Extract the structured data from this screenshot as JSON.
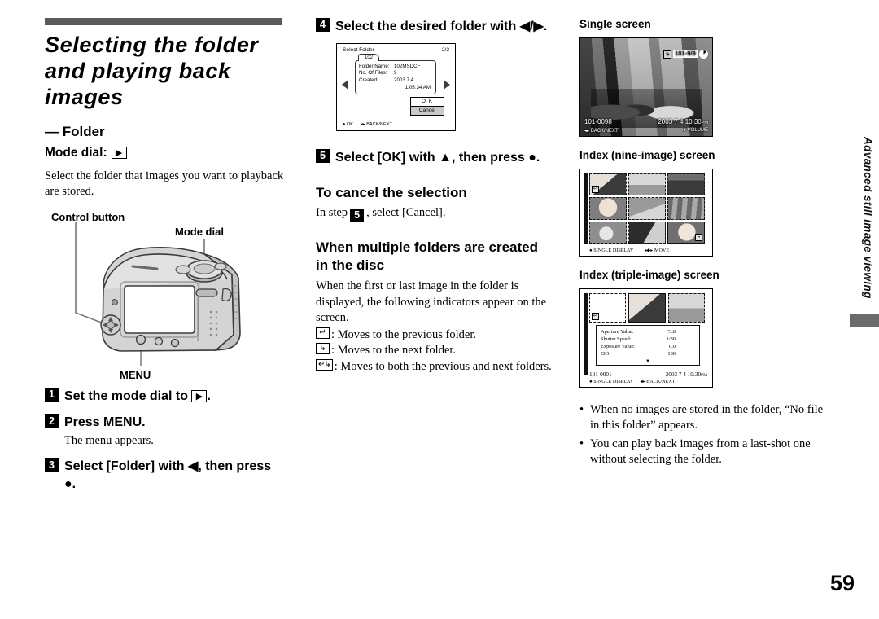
{
  "page_number": "59",
  "side_tab_text": "Advanced still image viewing",
  "left_column": {
    "title": "Selecting the folder and playing back images",
    "sub_head": "— Folder",
    "mode_dial_label": "Mode dial:",
    "mode_dial_icon": "playback-icon",
    "intro": "Select the folder that images you want to playback are stored.",
    "camera_labels": {
      "control_button": "Control button",
      "mode_dial": "Mode dial",
      "menu": "MENU"
    },
    "steps": [
      {
        "num": "1",
        "text": "Set the mode dial to ",
        "icon": "playback-icon",
        "tail": "."
      },
      {
        "num": "2",
        "text": "Press MENU.",
        "note": "The menu appears."
      },
      {
        "num": "3",
        "text": "Select [Folder] with ◀, then press ●."
      }
    ]
  },
  "middle_column": {
    "step4": {
      "num": "4",
      "text": "Select the desired folder with ◀/▶."
    },
    "select_folder_screen": {
      "title": "Select Folder",
      "counter": "2/2",
      "folder_tab": "102",
      "rows": [
        {
          "key": "Folder Name:",
          "value": "102MSDCF"
        },
        {
          "key": "No. Of Files:",
          "value": "9"
        },
        {
          "key": "Created:",
          "value": "2003  7  4"
        }
      ],
      "created_time": "1:05:34 AM",
      "ok_label": "O K",
      "cancel_label": "Cancel",
      "footer_ok": "OK",
      "footer_nav": "BACK/NEXT"
    },
    "step5": {
      "num": "5",
      "text": "Select [OK] with ▲, then press ●."
    },
    "cancel_head": "To cancel the selection",
    "cancel_text_a": "In step",
    "cancel_step_num": "5",
    "cancel_text_b": ", select [Cancel].",
    "multi_head": "When multiple folders are created in the disc",
    "multi_body": "When the first or last image in the folder is displayed, the following indicators appear on the screen.",
    "indicators": [
      {
        "icon": "previous-folder-icon",
        "glyph": "↵",
        "text": ": Moves to the previous folder."
      },
      {
        "icon": "next-folder-icon",
        "glyph": "↳",
        "text": ": Moves to the next folder."
      },
      {
        "icon": "both-folders-icon",
        "glyph": "↵↳",
        "text": ": Moves to both the previous and next folders."
      }
    ]
  },
  "right_column": {
    "single_screen": {
      "caption": "Single screen",
      "osd_folder_chip": "next-folder-icon",
      "osd_counter": "101-9/9",
      "osd_file": "101-0098",
      "osd_datetime": "2003  7  4  10:30",
      "osd_ampm": "PM",
      "osd_back_next": "BACK/NEXT",
      "osd_volume": "VOLUME"
    },
    "index_nine": {
      "caption": "Index (nine-image) screen",
      "footer_single": "SINGLE DISPLAY",
      "footer_move": "MOVE"
    },
    "index_triple": {
      "caption": "Index (triple-image) screen",
      "info_rows": [
        {
          "key": "Aperture Value:",
          "value": "F3.8"
        },
        {
          "key": "Shutter Speed:",
          "value": "1/30"
        },
        {
          "key": "Exposure Value:",
          "value": "0.0"
        },
        {
          "key": "ISO:",
          "value": "100"
        }
      ],
      "file_no": "101-0001",
      "datetime": "2003  7  4   10:30",
      "ampm": "PM",
      "footer_single": "SINGLE DISPLAY",
      "footer_back_next": "BACK/NEXT"
    },
    "notes": [
      "When no images are stored in the folder, “No file in this folder” appears.",
      "You can play back images from a last-shot one without selecting the folder."
    ]
  }
}
